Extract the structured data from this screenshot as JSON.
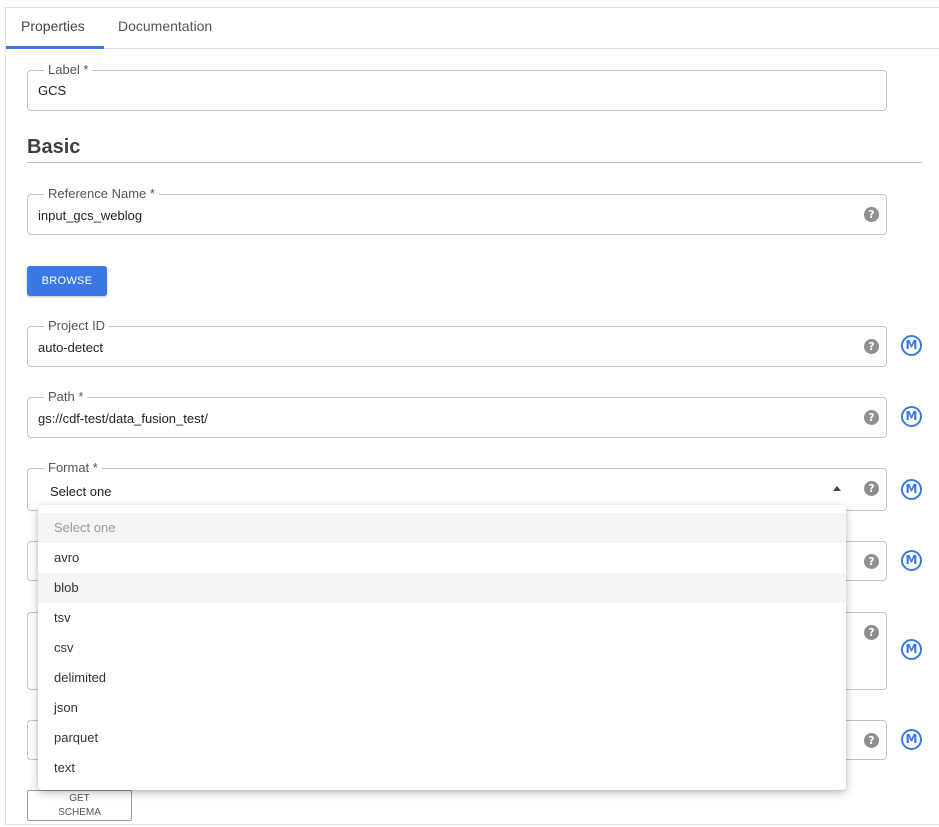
{
  "tabs": [
    {
      "label": "Properties",
      "active": true
    },
    {
      "label": "Documentation",
      "active": false
    }
  ],
  "fields": {
    "label": {
      "legend": "Label *",
      "value": "GCS"
    },
    "reference_name": {
      "legend": "Reference Name *",
      "value": "input_gcs_weblog"
    },
    "project_id": {
      "legend": "Project ID",
      "value": "auto-detect"
    },
    "path": {
      "legend": "Path *",
      "value": "gs://cdf-test/data_fusion_test/"
    },
    "format": {
      "legend": "Format *",
      "value": "Select one"
    }
  },
  "section": {
    "title": "Basic"
  },
  "buttons": {
    "browse": "BROWSE",
    "get_schema_line1": "GET",
    "get_schema_line2": "SCHEMA"
  },
  "icons": {
    "help": "?",
    "macro": "M"
  },
  "format_dropdown": {
    "placeholder": "Select one",
    "options": [
      "avro",
      "blob",
      "tsv",
      "csv",
      "delimited",
      "json",
      "parquet",
      "text"
    ],
    "hovered": "blob"
  },
  "colors": {
    "accent": "#3b78e7",
    "help_icon": "#8f8f8f"
  }
}
